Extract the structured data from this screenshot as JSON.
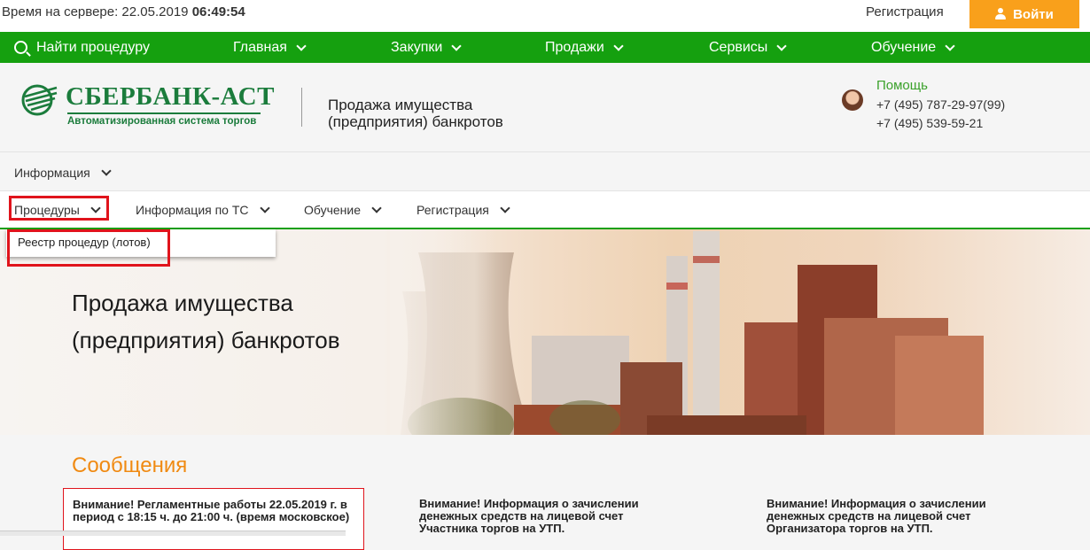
{
  "topbar": {
    "server_time_label": "Время на сервере: 22.05.2019",
    "server_time_value": "06:49:54",
    "register_link": "Регистрация",
    "login_button": "Войти"
  },
  "green_nav": {
    "search_label": "Найти процедуру",
    "items": [
      "Главная",
      "Закупки",
      "Продажи",
      "Сервисы",
      "Обучение"
    ]
  },
  "header": {
    "logo_title": "СБЕРБАНК-АСТ",
    "logo_subtitle": "Автоматизированная система торгов",
    "section_title": "Продажа имущества (предприятия) банкротов",
    "help_label": "Помощь",
    "phone1": "+7 (495) 787-29-97(99)",
    "phone2": "+7 (495) 539-59-21"
  },
  "info_menu": {
    "label": "Информация"
  },
  "sub_nav": {
    "items": [
      "Процедуры",
      "Информация по ТС",
      "Обучение",
      "Регистрация"
    ],
    "dropdown_item": "Реестр процедур (лотов)"
  },
  "hero": {
    "line1": "Продажа имущества",
    "line2": "(предприятия) банкротов"
  },
  "messages": {
    "title": "Сообщения",
    "items": [
      "Внимание! Регламентные работы 22.05.2019 г. в период с 18:15 ч. до 21:00 ч. (время московское)",
      "Внимание! Информация о зачислении денежных средств на лицевой счет Участника торгов на УТП.",
      "Внимание! Информация о зачислении денежных средств на лицевой счет Организатора торгов на УТП."
    ]
  },
  "colors": {
    "green": "#15a00f",
    "orange": "#f9a01b",
    "brand_green": "#1b7c3c",
    "alert_red": "#e0141c",
    "messages_title": "#f08a12"
  }
}
